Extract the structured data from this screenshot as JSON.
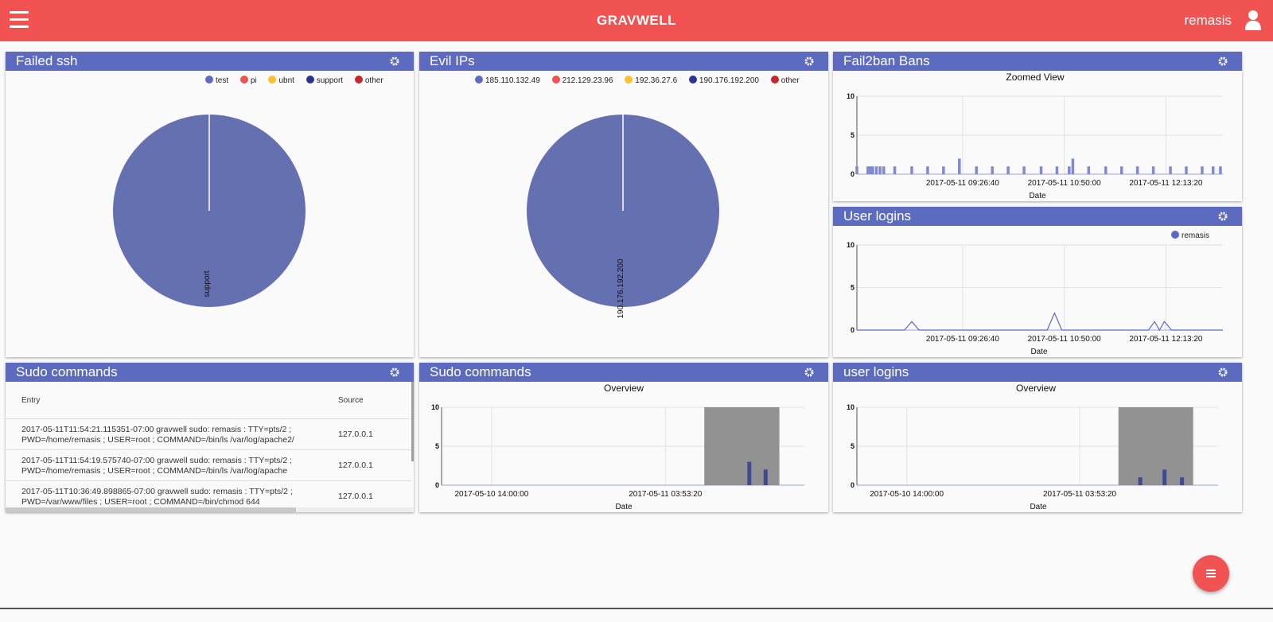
{
  "header": {
    "brand": "GRAVWELL",
    "user": "remasis"
  },
  "colors": {
    "accent": "#f05351",
    "panel_header": "#5c6bc0",
    "series": "#6570b1"
  },
  "icons": {
    "menu": "hamburger-icon",
    "user": "user-icon",
    "settings": "gear-icon",
    "fab": "list-icon"
  },
  "panels": {
    "failed_ssh": {
      "title": "Failed ssh",
      "legend": [
        {
          "label": "test",
          "color": "#5c6bc0"
        },
        {
          "label": "pi",
          "color": "#ef5350"
        },
        {
          "label": "ubnt",
          "color": "#fbc02d"
        },
        {
          "label": "support",
          "color": "#283593"
        },
        {
          "label": "other",
          "color": "#c62828"
        }
      ],
      "slice_label": "support"
    },
    "evil_ips": {
      "title": "Evil IPs",
      "legend": [
        {
          "label": "185.110.132.49",
          "color": "#5c6bc0"
        },
        {
          "label": "212.129.23.96",
          "color": "#ef5350"
        },
        {
          "label": "192.36.27.6",
          "color": "#fbc02d"
        },
        {
          "label": "190.176.192.200",
          "color": "#283593"
        },
        {
          "label": "other",
          "color": "#c62828"
        }
      ],
      "slice_label": "190.176.192.200"
    },
    "fail2ban": {
      "title": "Fail2ban Bans",
      "subtitle": "Zoomed View",
      "xlabel": "Date"
    },
    "user_logins": {
      "title": "User logins",
      "xlabel": "Date",
      "legend": "remasis"
    },
    "sudo_table": {
      "title": "Sudo commands",
      "columns": [
        "Entry",
        "Source"
      ],
      "rows": [
        {
          "line1": "2017-05-11T11:54:21.115351-07:00 gravwell sudo: remasis : TTY=pts/2 ;",
          "line2": "PWD=/home/remasis ; USER=root ; COMMAND=/bin/ls /var/log/apache2/",
          "source": "127.0.0.1"
        },
        {
          "line1": "2017-05-11T11:54:19.575740-07:00 gravwell sudo: remasis : TTY=pts/2 ;",
          "line2": "PWD=/home/remasis ; USER=root ; COMMAND=/bin/ls /var/log/apache",
          "source": "127.0.0.1"
        },
        {
          "line1": "2017-05-11T10:36:49.898865-07:00 gravwell sudo: remasis : TTY=pts/2 ;",
          "line2": "PWD=/var/www/files ; USER=root ; COMMAND=/bin/chmod 644",
          "source": "127.0.0.1"
        }
      ]
    },
    "sudo_chart": {
      "title": "Sudo commands",
      "subtitle": "Overview",
      "xlabel": "Date"
    },
    "user_logins_overview": {
      "title": "user logins",
      "subtitle": "Overview",
      "xlabel": "Date"
    }
  },
  "chart_data": [
    {
      "type": "pie",
      "panel": "Failed ssh",
      "categories": [
        "test",
        "pi",
        "ubnt",
        "support",
        "other"
      ],
      "values": [
        0,
        0,
        0,
        100,
        0
      ]
    },
    {
      "type": "pie",
      "panel": "Evil IPs",
      "categories": [
        "185.110.132.49",
        "212.129.23.96",
        "192.36.27.6",
        "190.176.192.200",
        "other"
      ],
      "values": [
        0,
        0,
        0,
        100,
        0
      ]
    },
    {
      "type": "bar",
      "panel": "Fail2ban Bans",
      "title": "Zoomed View",
      "xlabel": "Date",
      "ylabel": "",
      "ylim": [
        0,
        10
      ],
      "yticks": [
        "0",
        "5",
        "10"
      ],
      "xticks": [
        "2017-05-11 09:26:40",
        "2017-05-11 10:50:00",
        "2017-05-11 12:13:20"
      ],
      "x": [
        "2017-05-11 08:00",
        "2017-05-11 08:09",
        "2017-05-11 08:11",
        "2017-05-11 08:13",
        "2017-05-11 08:16",
        "2017-05-11 08:19",
        "2017-05-11 08:22",
        "2017-05-11 08:31",
        "2017-05-11 08:45",
        "2017-05-11 08:58",
        "2017-05-11 09:11",
        "2017-05-11 09:24",
        "2017-05-11 09:38",
        "2017-05-11 09:51",
        "2017-05-11 10:04",
        "2017-05-11 10:17",
        "2017-05-11 10:31",
        "2017-05-11 10:44",
        "2017-05-11 10:54",
        "2017-05-11 10:57",
        "2017-05-11 11:10",
        "2017-05-11 11:24",
        "2017-05-11 11:37",
        "2017-05-11 11:50",
        "2017-05-11 12:03",
        "2017-05-11 12:17",
        "2017-05-11 12:30",
        "2017-05-11 12:43",
        "2017-05-11 12:52",
        "2017-05-11 12:58"
      ],
      "values": [
        1,
        1,
        1,
        1,
        1,
        1,
        1,
        1,
        1,
        1,
        1,
        2,
        1,
        1,
        1,
        1,
        1,
        1,
        1,
        2,
        1,
        1,
        1,
        1,
        1,
        1,
        1,
        1,
        1,
        1
      ]
    },
    {
      "type": "line",
      "panel": "User logins",
      "xlabel": "Date",
      "ylim": [
        0,
        10
      ],
      "yticks": [
        "0",
        "5",
        "10"
      ],
      "xticks": [
        "2017-05-11 09:26:40",
        "2017-05-11 10:50:00",
        "2017-05-11 12:13:20"
      ],
      "series": [
        {
          "name": "remasis",
          "x": [
            "2017-05-11 08:00",
            "2017-05-11 08:39",
            "2017-05-11 08:45",
            "2017-05-11 08:51",
            "2017-05-11 10:36",
            "2017-05-11 10:42",
            "2017-05-11 10:48",
            "2017-05-11 11:59",
            "2017-05-11 12:04",
            "2017-05-11 12:08",
            "2017-05-11 12:12",
            "2017-05-11 12:18",
            "2017-05-11 13:00"
          ],
          "values": [
            0,
            0,
            1,
            0,
            0,
            2,
            0,
            0,
            1,
            0,
            1,
            0,
            0
          ]
        }
      ]
    },
    {
      "type": "bar",
      "panel": "Sudo commands",
      "title": "Overview",
      "xlabel": "Date",
      "ylim": [
        0,
        10
      ],
      "yticks": [
        "0",
        "5",
        "10"
      ],
      "xticks": [
        "2017-05-10 14:00:00",
        "2017-05-11 03:53:20"
      ],
      "x": [
        "2017-05-11 10:36",
        "2017-05-11 11:54"
      ],
      "values": [
        3,
        2
      ],
      "selection": [
        "2017-05-11 07:00",
        "2017-05-11 13:00"
      ]
    },
    {
      "type": "bar",
      "panel": "user logins",
      "title": "Overview",
      "xlabel": "Date",
      "ylim": [
        0,
        10
      ],
      "yticks": [
        "0",
        "5",
        "10"
      ],
      "xticks": [
        "2017-05-10 14:00:00",
        "2017-05-11 03:53:20"
      ],
      "x": [
        "2017-05-11 08:45",
        "2017-05-11 10:42",
        "2017-05-11 12:06"
      ],
      "values": [
        1,
        2,
        1
      ],
      "selection": [
        "2017-05-11 07:00",
        "2017-05-11 13:00"
      ]
    }
  ]
}
